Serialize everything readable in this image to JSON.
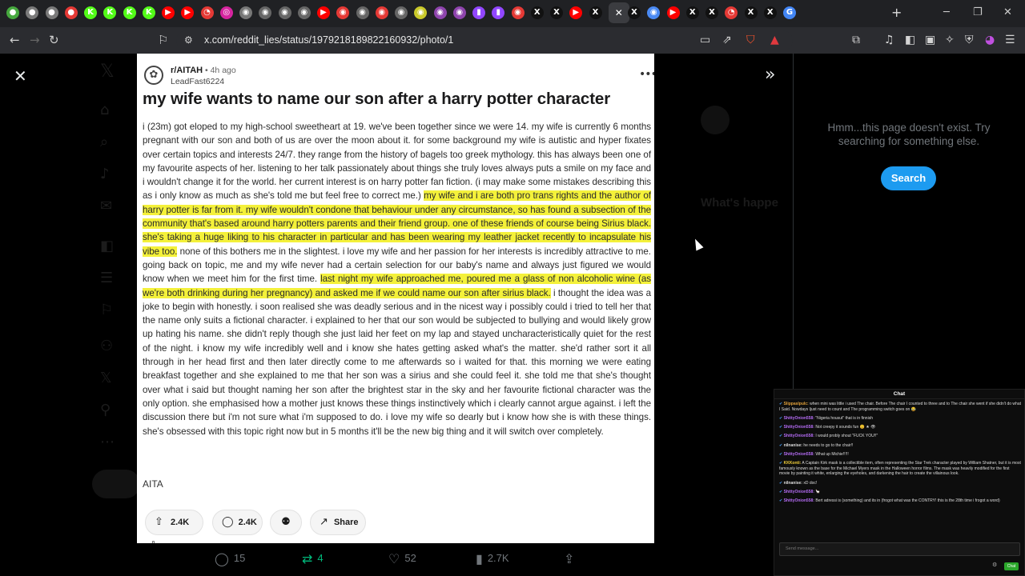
{
  "browser": {
    "url": "x.com/reddit_lies/status/1979218189822160932/photo/1",
    "new_tab_label": "+",
    "tabs": [
      {
        "glyph": "●",
        "color": "#46a83e"
      },
      {
        "glyph": "●",
        "color": "#7a7a7a"
      },
      {
        "glyph": "●",
        "color": "#7a7a7a"
      },
      {
        "glyph": "●",
        "color": "#e53935"
      },
      {
        "glyph": "K",
        "color": "#53fc18"
      },
      {
        "glyph": "K",
        "color": "#53fc18"
      },
      {
        "glyph": "K",
        "color": "#53fc18"
      },
      {
        "glyph": "K",
        "color": "#53fc18"
      },
      {
        "glyph": "▶",
        "color": "#ff0000"
      },
      {
        "glyph": "▶",
        "color": "#ff0000"
      },
      {
        "glyph": "◔",
        "color": "#e53935"
      },
      {
        "glyph": "◎",
        "color": "#d6249f"
      },
      {
        "glyph": "◉",
        "color": "#777"
      },
      {
        "glyph": "◉",
        "color": "#666"
      },
      {
        "glyph": "◉",
        "color": "#666"
      },
      {
        "glyph": "◉",
        "color": "#666"
      },
      {
        "glyph": "▶",
        "color": "#ff0000"
      },
      {
        "glyph": "◉",
        "color": "#e53935"
      },
      {
        "glyph": "◉",
        "color": "#666"
      },
      {
        "glyph": "◉",
        "color": "#e53935"
      },
      {
        "glyph": "◉",
        "color": "#666"
      },
      {
        "glyph": "◉",
        "color": "#c9c92a"
      },
      {
        "glyph": "◉",
        "color": "#8e44ad"
      },
      {
        "glyph": "◉",
        "color": "#8e44ad"
      },
      {
        "glyph": "▮",
        "color": "#9146ff"
      },
      {
        "glyph": "▮",
        "color": "#9146ff"
      },
      {
        "glyph": "◉",
        "color": "#e53935"
      },
      {
        "glyph": "X",
        "color": "#111"
      },
      {
        "glyph": "X",
        "color": "#111"
      },
      {
        "glyph": "▶",
        "color": "#ff0000"
      },
      {
        "glyph": "X",
        "color": "#111"
      },
      {
        "glyph": "✕",
        "color": "#3b3c40",
        "active": true
      },
      {
        "glyph": "X",
        "color": "#111"
      },
      {
        "glyph": "◉",
        "color": "#4a8af4"
      },
      {
        "glyph": "▶",
        "color": "#ff0000"
      },
      {
        "glyph": "X",
        "color": "#111"
      },
      {
        "glyph": "X",
        "color": "#111"
      },
      {
        "glyph": "◔",
        "color": "#e53935"
      },
      {
        "glyph": "X",
        "color": "#111"
      },
      {
        "glyph": "X",
        "color": "#111"
      },
      {
        "glyph": "G",
        "color": "#4285f4"
      }
    ]
  },
  "reddit": {
    "subreddit": "r/AITAH",
    "time": "• 4h ago",
    "user": "LeadFast6224",
    "title": "my wife wants to name our son after a harry potter character",
    "body": [
      {
        "t": "i (23m) got eloped to my high-school sweetheart at 19. we've been together since we were 14. my wife is currently 6 months pregnant with our son and both of us are over the moon about it. for some background my wife is autistic and hyper fixates over certain topics and interests 24/7. they range from the history of bagels too greek mythology. this has always been one of my favourite aspects of her. listening to her talk passionately about things she truly loves always puts a smile on my face and i wouldn't change it for the world. her current interest is on harry potter fan fiction. (i may make some mistakes describing this as i only know as much as she's told me but feel free to correct me.) ",
        "hl": false
      },
      {
        "t": "my wife and i are both pro trans rights and the author of harry potter is far from it. my wife wouldn't condone that behaviour under any circumstance, so has found a subsection of the community that's based around harry potters parents and their friend group. one of these friends of course being Sirius black. she's taking a huge liking to his character in particular and has been wearing my leather jacket recently to incapsulate his vibe too.",
        "hl": true
      },
      {
        "t": " none of this bothers me in the slightest. i love my wife and her passion for her interests is incredibly attractive to me. going back on topic, me and my wife never had a certain selection for our baby's name and always just figured we would know when we meet him for the first time. ",
        "hl": false
      },
      {
        "t": "last night my wife approached me, poured me a glass of non alcoholic wine (as we're both drinking during her pregnancy) and asked me if we could name our son after sirius black.",
        "hl": true
      },
      {
        "t": " i thought the idea was a joke to begin with honestly. i soon realised she was deadly serious and in the nicest way i possibly could i tried to tell her that the name only suits a fictional character. i explained to her that our son would be subjected to bullying and would likely grow up hating his name. she didn't reply though she just laid her feet on my lap and stayed uncharacteristically quiet for the rest of the night. i know my wife incredibly well and i know she hates getting asked what's the matter. she'd rather sort it all through in her head first and then later directly come to me afterwards so i waited for that. this morning we were eating breakfast together and she explained to me that her son was a sirius and she could feel it. she told me that she's thought over what i said but thought naming her son after the brightest star in the sky and her favourite fictional character was the only option. she emphasised how a mother just knows these things instinctively which i clearly cannot argue against. i left the discussion there but i'm not sure what i'm supposed to do. i love my wife so dearly but i know how she is with these things. she's obsessed with this topic right now but in 5 months it'll be the new big thing and it will switch over completely.",
        "hl": false
      }
    ],
    "footer": "AITA",
    "votes": "2.4K",
    "comments": "2.4K",
    "share": "Share"
  },
  "x_side": {
    "not_found_msg": "Hmm...this page doesn't exist. Try searching for something else.",
    "search_button": "Search"
  },
  "x_actions": {
    "replies": "15",
    "reposts": "4",
    "likes": "52",
    "views": "2.7K"
  },
  "chat": {
    "title": "Chat",
    "placeholder": "Send message...",
    "send": "Chat",
    "messages": [
      {
        "u": "Slippaslpulc:",
        "c": "#e0a03a",
        "m": " when mini was little i used The chair. Before The chair I counted to three and to The chair she went if she didn't do what I Said. Nowdays Ijust need to count and The programming switch goes on 😂"
      },
      {
        "u": "ShittyOnion558:",
        "c": "#b56cf5",
        "m": " \"Nigeria housut\" that is in finnish"
      },
      {
        "u": "ShittyOnion558:",
        "c": "#b56cf5",
        "m": " Not creepy it sounds fun 😊 ★ 👁"
      },
      {
        "u": "ShittyOnion558:",
        "c": "#b56cf5",
        "m": " I would probly shout \"FUCK YOU!!\""
      },
      {
        "u": "nilnanise:",
        "c": "#dcdcdc",
        "m": " he needs to go to the chair!!"
      },
      {
        "u": "ShittyOnion558:",
        "c": "#b56cf5",
        "m": " What up Michie!!!!!"
      },
      {
        "u": "KKKonti:",
        "c": "#f2d03a",
        "m": " A Captain Kirk mask is a collectible item, often representing the Star Trek character played by William Shatner, but it is most famously known as the base for the Michael Myers mask in the Halloween horror films. The mask was heavily modified for the first movie by painting it white, enlarging the eyeholes, and darkening the hair to create the villainous look."
      },
      {
        "u": "nilnanise:",
        "c": "#dcdcdc",
        "m": " xD doc!"
      },
      {
        "u": "ShittyOnion558:",
        "c": "#b56cf5",
        "m": " 🦙"
      },
      {
        "u": "ShittyOnion558:",
        "c": "#b56cf5",
        "m": " Bert adressi is (something) and its in (frogot what was the CONTRY! this is the 28th time i frogot a word)"
      }
    ]
  }
}
